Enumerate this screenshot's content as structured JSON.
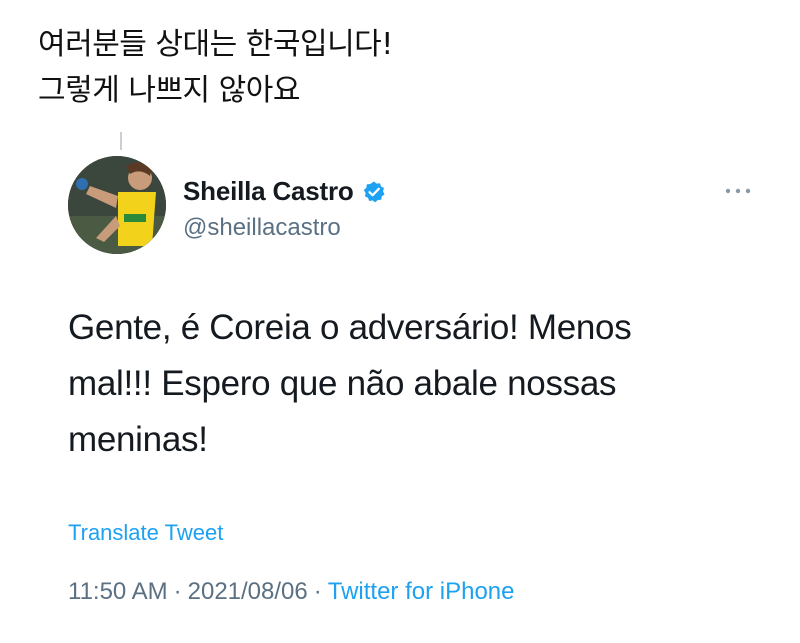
{
  "caption": {
    "line1": "여러분들 상대는 한국입니다!",
    "line2": "그렇게 나쁘지 않아요"
  },
  "tweet": {
    "display_name": "Sheilla Castro",
    "handle": "@sheillacastro",
    "text_lines": [
      "Gente, é Coreia o adversário! Menos",
      "mal!!! Espero que não abale nossas",
      "meninas!"
    ],
    "translate_label": "Translate Tweet",
    "time": "11:50 AM",
    "date": "2021/08/06",
    "separator": "·",
    "source": "Twitter for iPhone",
    "icons": {
      "verified": "verified-badge-icon",
      "more": "more-options-icon"
    }
  },
  "colors": {
    "link": "#1da1f2",
    "secondary_text": "#5b7083",
    "primary_text": "#141a1f"
  }
}
